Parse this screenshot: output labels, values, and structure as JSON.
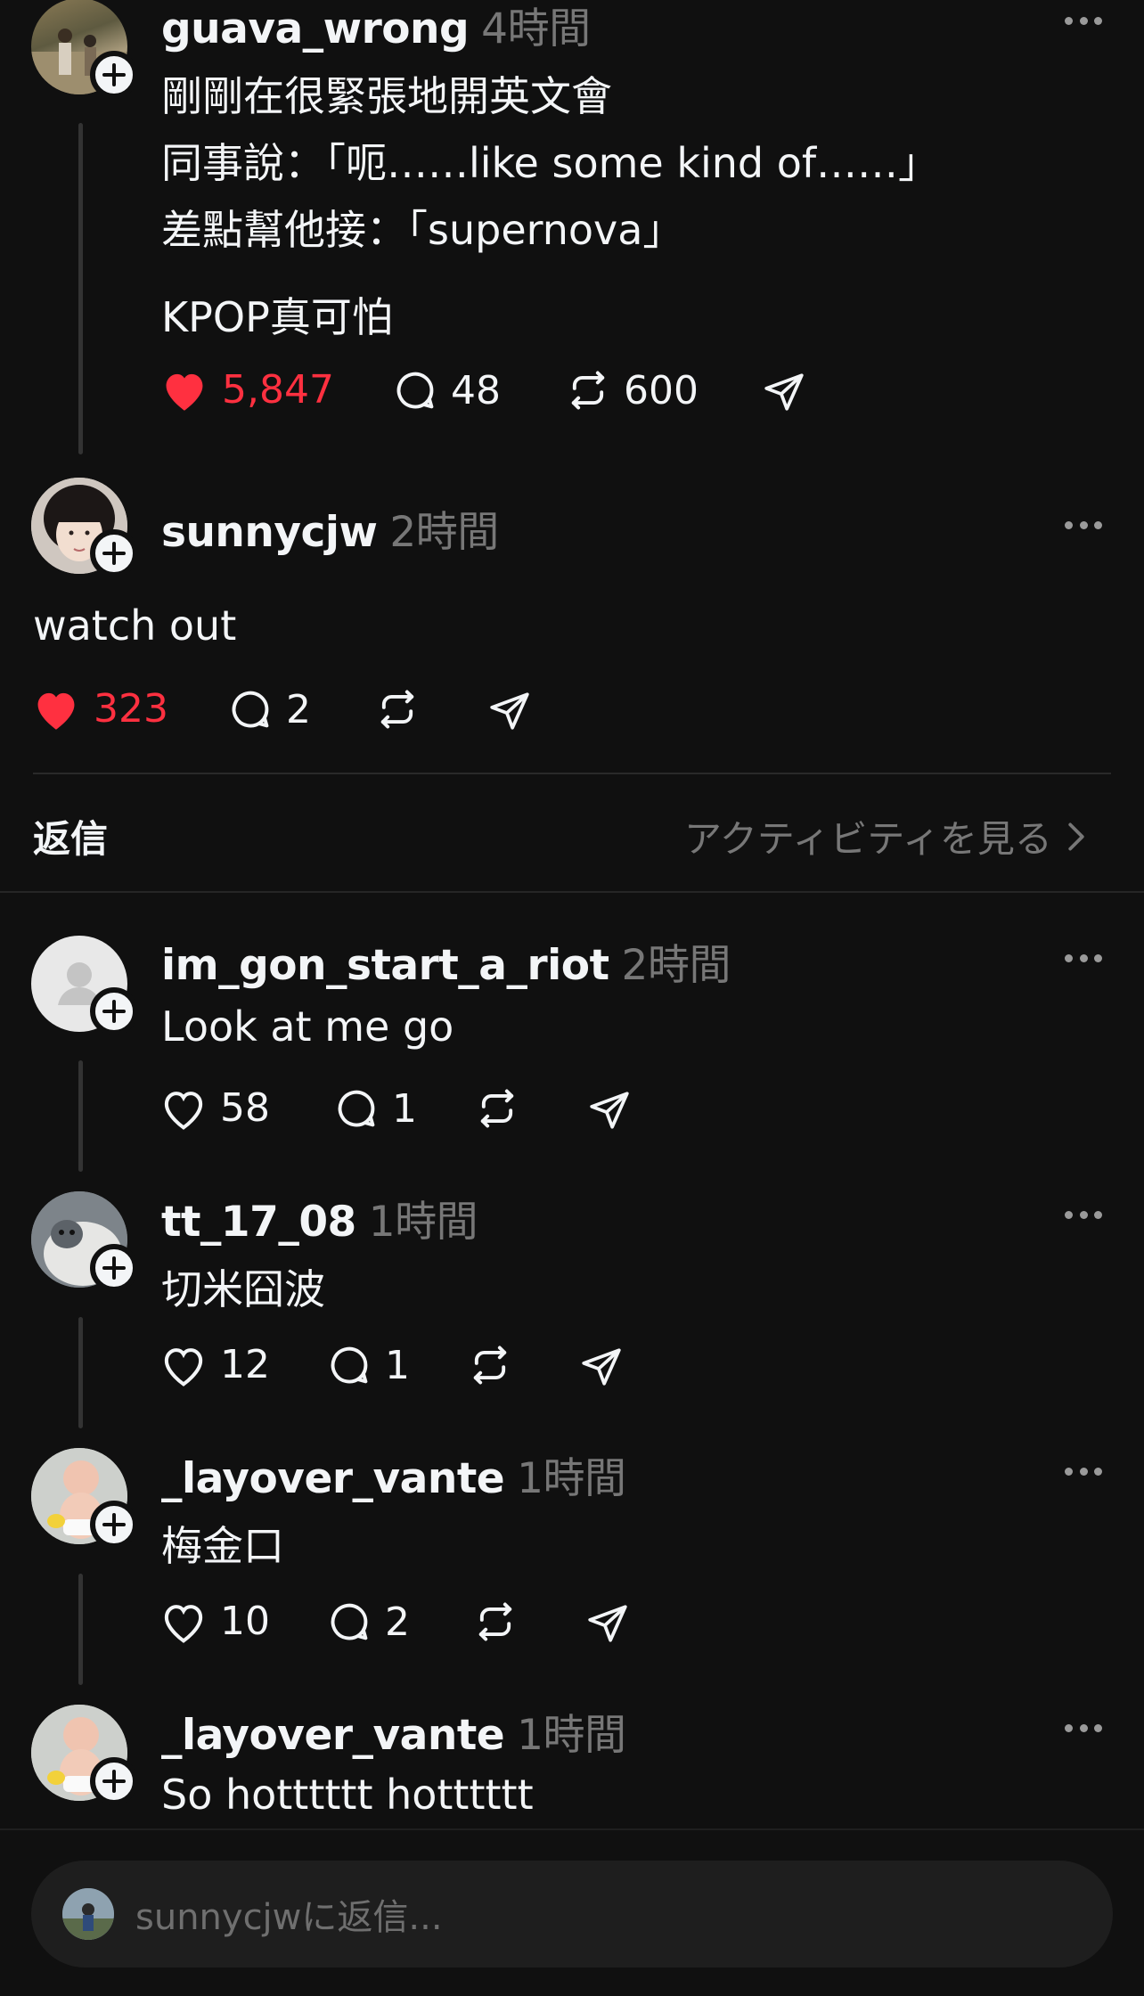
{
  "main_post": {
    "username": "guava_wrong",
    "time": "4時間",
    "lines": [
      "剛剛在很緊張地開英文會",
      "同事說：「呃……like some kind of……」",
      "差點幫他接：「supernova」",
      "KPOP真可怕"
    ],
    "likes": "5,847",
    "comments": "48",
    "reposts": "600"
  },
  "focused_reply": {
    "username": "sunnycjw",
    "time": "2時間",
    "text": "watch out",
    "likes": "323",
    "comments": "2"
  },
  "replies_header": {
    "title": "返信",
    "activity_link": "アクティビティを見る"
  },
  "replies": [
    {
      "username": "im_gon_start_a_riot",
      "time": "2時間",
      "text": "Look at me go",
      "likes": "58",
      "comments": "1"
    },
    {
      "username": "tt_17_08",
      "time": "1時間",
      "text": "切米囧波",
      "likes": "12",
      "comments": "1"
    },
    {
      "username": "_layover_vante",
      "time": "1時間",
      "text": "梅金口",
      "likes": "10",
      "comments": "2"
    },
    {
      "username": "_layover_vante",
      "time": "1時間",
      "text": "So hotttttt hotttttt"
    }
  ],
  "composer": {
    "placeholder": "sunnycjwに返信..."
  },
  "colors": {
    "background": "#101010",
    "like_red": "#ff3040",
    "secondary_text": "#777777"
  }
}
